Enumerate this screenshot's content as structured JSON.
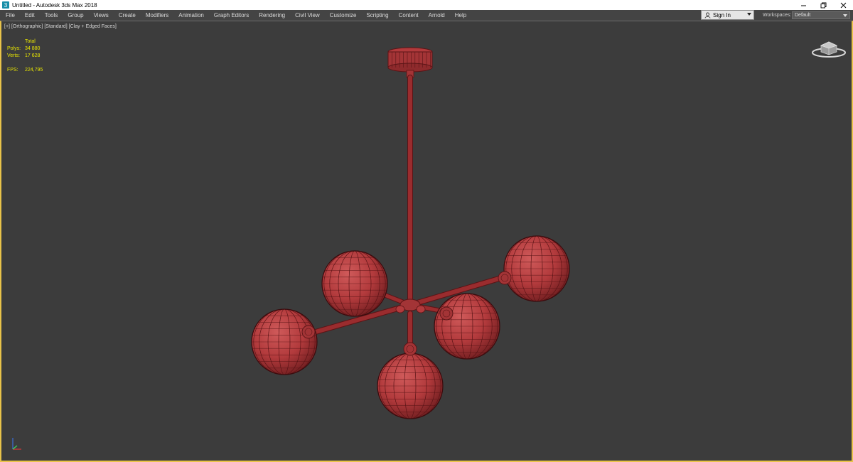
{
  "window": {
    "title": "Untitled - Autodesk 3ds Max 2018",
    "app_icon": "3ds-max-icon",
    "controls": [
      "minimize-icon",
      "restore-icon",
      "close-icon"
    ]
  },
  "menu": {
    "items": [
      "File",
      "Edit",
      "Tools",
      "Group",
      "Views",
      "Create",
      "Modifiers",
      "Animation",
      "Graph Editors",
      "Rendering",
      "Civil View",
      "Customize",
      "Scripting",
      "Content",
      "Arnold",
      "Help"
    ],
    "sign_in": "Sign In",
    "workspaces_label": "Workspaces:",
    "workspaces_value": "Default"
  },
  "viewport": {
    "label_plus": "[+]",
    "label_view": "[Orthographic]",
    "label_shading": "[Standard]",
    "label_mode": "[Clay + Edged Faces]",
    "stats": {
      "header": "Total",
      "polys_label": "Polys:",
      "polys_value": "34 880",
      "verts_label": "Verts:",
      "verts_value": "17 628",
      "fps_label": "FPS:",
      "fps_value": "224,795"
    },
    "colors": {
      "background": "#3c3c3c",
      "active_border": "#e9c34a",
      "model": "#b23a3c",
      "wire": "#5a1416",
      "stats_text": "#e9e600"
    }
  }
}
